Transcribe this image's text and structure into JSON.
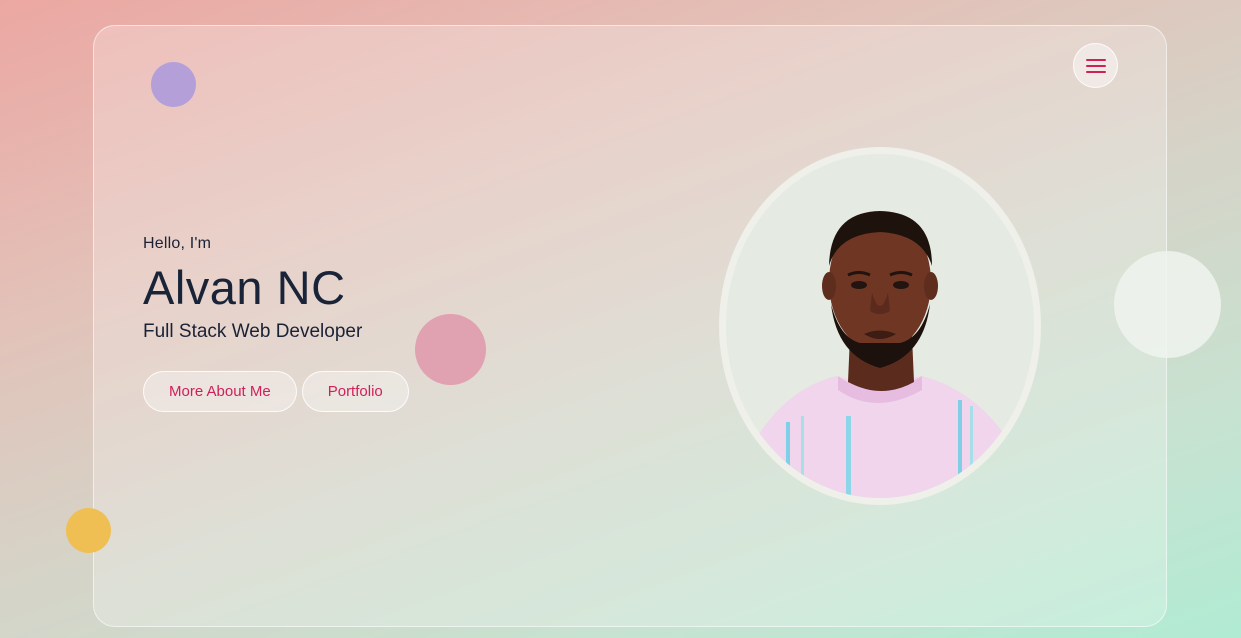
{
  "hero": {
    "greeting": "Hello, I'm",
    "name": "Alvan NC",
    "role": "Full Stack Web Developer"
  },
  "buttons": {
    "more_about_me": "More About Me",
    "portfolio": "Portfolio"
  },
  "header": {
    "menu_icon": "hamburger-menu-icon"
  },
  "colors": {
    "accent": "#d11f57",
    "text_primary": "#1a2438",
    "bubble_purple": "#b49fd8",
    "bubble_pink": "#e0a1b0",
    "bubble_yellow": "#f0bf54"
  }
}
